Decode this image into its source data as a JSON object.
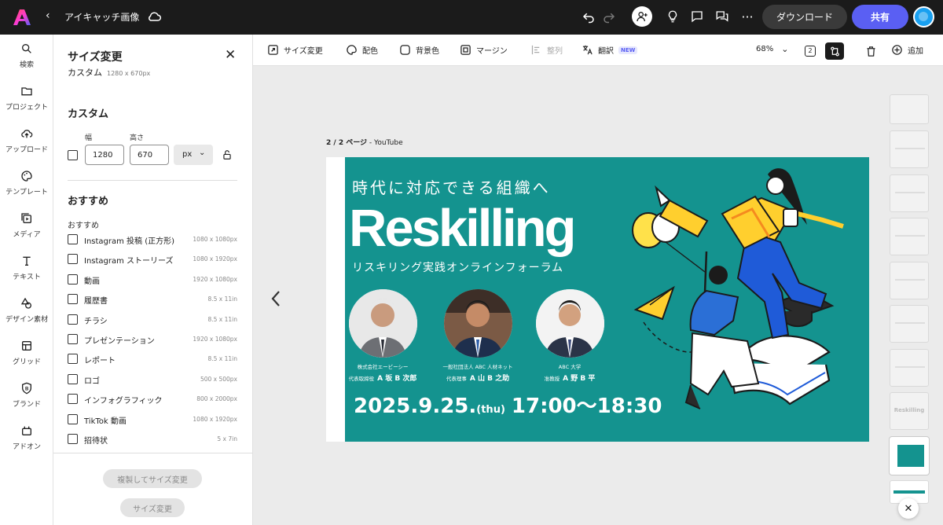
{
  "topbar": {
    "doc_title": "アイキャッチ画像",
    "download_label": "ダウンロード",
    "share_label": "共有"
  },
  "rail": {
    "items": [
      {
        "label": "検索"
      },
      {
        "label": "プロジェクト"
      },
      {
        "label": "アップロード"
      },
      {
        "label": "テンプレート"
      },
      {
        "label": "メディア"
      },
      {
        "label": "テキスト"
      },
      {
        "label": "デザイン素材"
      },
      {
        "label": "グリッド"
      },
      {
        "label": "ブランド"
      },
      {
        "label": "アドオン"
      }
    ]
  },
  "panel": {
    "title": "サイズ変更",
    "subtitle": "カスタム",
    "subtitle_size": "1280 x 670px",
    "custom_heading": "カスタム",
    "width_label": "幅",
    "height_label": "高さ",
    "width_value": "1280",
    "height_value": "670",
    "unit": "px",
    "recommended_heading": "おすすめ",
    "recommended_label": "おすすめ",
    "presets": [
      {
        "name": "Instagram 投稿 (正方形)",
        "size": "1080 x 1080px"
      },
      {
        "name": "Instagram ストーリーズ",
        "size": "1080 x 1920px"
      },
      {
        "name": "動画",
        "size": "1920 x 1080px"
      },
      {
        "name": "履歴書",
        "size": "8.5 x 11in"
      },
      {
        "name": "チラシ",
        "size": "8.5 x 11in"
      },
      {
        "name": "プレゼンテーション",
        "size": "1920 x 1080px"
      },
      {
        "name": "レポート",
        "size": "8.5 x 11in"
      },
      {
        "name": "ロゴ",
        "size": "500 x 500px"
      },
      {
        "name": "インフォグラフィック",
        "size": "800 x 2000px"
      },
      {
        "name": "TikTok 動画",
        "size": "1080 x 1920px"
      },
      {
        "name": "招待状",
        "size": "5 x 7in"
      }
    ],
    "copy_resize_label": "複製してサイズ変更",
    "resize_label": "サイズ変更"
  },
  "toolbar": {
    "resize": "サイズ変更",
    "color": "配色",
    "background": "背景色",
    "margin": "マージン",
    "align": "整列",
    "translate": "翻訳",
    "new_badge": "NEW",
    "zoom": "68%",
    "page_count": "2",
    "add": "追加"
  },
  "canvas": {
    "page_label_bold": "2 / 2 ページ",
    "page_label_rest": " - YouTube"
  },
  "design": {
    "heading": "時代に対応できる組織へ",
    "brand": "Reskilling",
    "subheading": "リスキリング実践オンラインフォーラム",
    "speakers": [
      {
        "org": "株式会社エービーシー",
        "role": "代表取締役",
        "name": "A 坂 B 次郎"
      },
      {
        "org": "一般社団法人 ABC 人材ネット",
        "role": "代表理事",
        "name": "A 山 B 之助"
      },
      {
        "org": "ABC 大学",
        "role": "准教授",
        "name": "A 野 B 平"
      }
    ],
    "date": "2025.9.25.",
    "weekday": "(thu)",
    "time": "17:00〜18:30"
  },
  "thumbs": {
    "brand_thumb": "Reskilling"
  },
  "colors": {
    "teal": "#14938f",
    "accent": "#5a5ff3",
    "dark": "#1b1b1b"
  }
}
